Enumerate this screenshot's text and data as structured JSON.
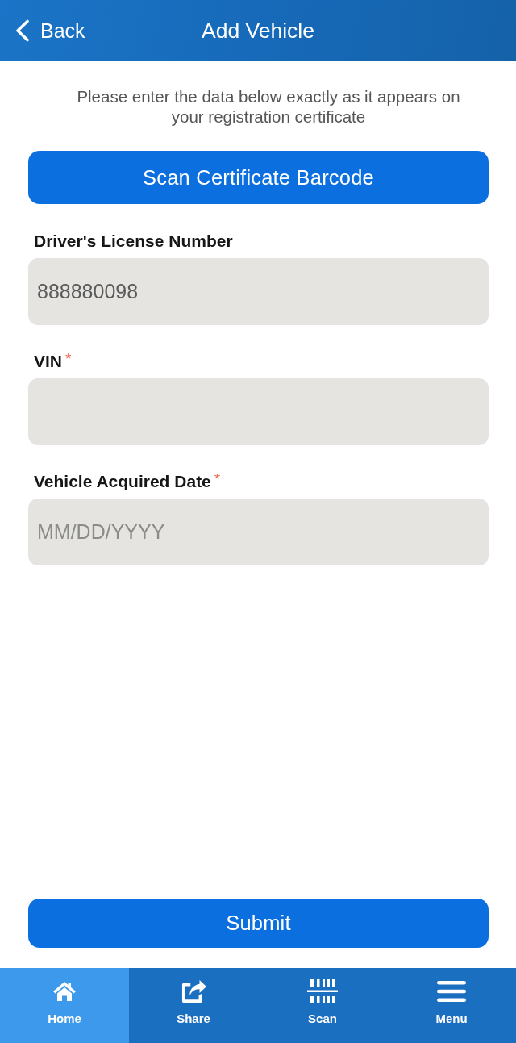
{
  "header": {
    "back": "Back",
    "title": "Add Vehicle"
  },
  "intro": "Please enter the data below exactly as it appears on your registration certificate",
  "scan_button": "Scan Certificate Barcode",
  "fields": [
    {
      "label": "Driver's License Number",
      "value": "888880098"
    },
    {
      "label": "VIN",
      "required_mark": "*"
    },
    {
      "label": "Vehicle Acquired Date",
      "required_mark": "*",
      "placeholder": "MM/DD/YYYY"
    }
  ],
  "submit_button": "Submit",
  "nav": [
    {
      "label": "Home",
      "selected": true
    },
    {
      "label": "Share",
      "selected": false
    },
    {
      "label": "Scan",
      "selected": false
    },
    {
      "label": "Menu",
      "selected": false
    }
  ]
}
